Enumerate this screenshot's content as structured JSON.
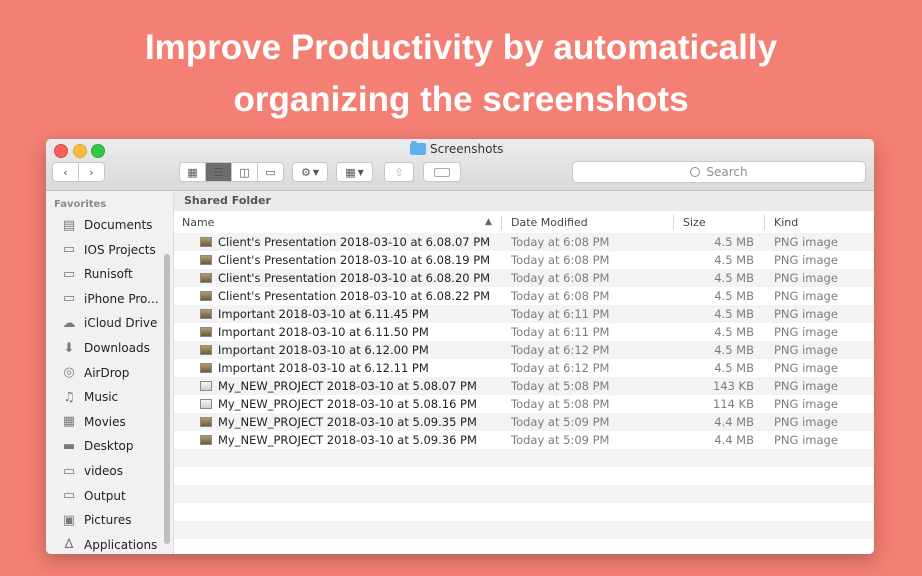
{
  "headline": {
    "line1": "Improve Productivity by automatically",
    "line2": "organizing the screenshots"
  },
  "window": {
    "title": "Screenshots",
    "search_placeholder": "Search",
    "back_icon": "chevron-left",
    "forward_icon": "chevron-right"
  },
  "sidebar": {
    "heading": "Favorites",
    "items": [
      {
        "label": "Documents",
        "icon": "documents-icon"
      },
      {
        "label": "IOS Projects",
        "icon": "folder-icon"
      },
      {
        "label": "Runisoft",
        "icon": "folder-icon"
      },
      {
        "label": "iPhone Pro...",
        "icon": "folder-icon"
      },
      {
        "label": "iCloud Drive",
        "icon": "cloud-icon"
      },
      {
        "label": "Downloads",
        "icon": "downloads-icon"
      },
      {
        "label": "AirDrop",
        "icon": "airdrop-icon"
      },
      {
        "label": "Music",
        "icon": "music-icon"
      },
      {
        "label": "Movies",
        "icon": "movies-icon"
      },
      {
        "label": "Desktop",
        "icon": "desktop-icon"
      },
      {
        "label": "videos",
        "icon": "folder-icon"
      },
      {
        "label": "Output",
        "icon": "folder-icon"
      },
      {
        "label": "Pictures",
        "icon": "pictures-icon"
      },
      {
        "label": "Applications",
        "icon": "applications-icon"
      }
    ]
  },
  "content": {
    "section": "Shared Folder",
    "columns": {
      "name": "Name",
      "date": "Date Modified",
      "size": "Size",
      "kind": "Kind"
    },
    "files": [
      {
        "name": "Client's Presentation 2018-03-10 at 6.08.07 PM",
        "date": "Today at 6:08 PM",
        "size": "4.5 MB",
        "kind": "PNG image"
      },
      {
        "name": "Client's Presentation 2018-03-10 at 6.08.19 PM",
        "date": "Today at 6:08 PM",
        "size": "4.5 MB",
        "kind": "PNG image"
      },
      {
        "name": "Client's Presentation 2018-03-10 at 6.08.20 PM",
        "date": "Today at 6:08 PM",
        "size": "4.5 MB",
        "kind": "PNG image"
      },
      {
        "name": "Client's Presentation 2018-03-10 at 6.08.22 PM",
        "date": "Today at 6:08 PM",
        "size": "4.5 MB",
        "kind": "PNG image"
      },
      {
        "name": "Important 2018-03-10 at 6.11.45 PM",
        "date": "Today at 6:11 PM",
        "size": "4.5 MB",
        "kind": "PNG image"
      },
      {
        "name": "Important 2018-03-10 at 6.11.50 PM",
        "date": "Today at 6:11 PM",
        "size": "4.5 MB",
        "kind": "PNG image"
      },
      {
        "name": "Important 2018-03-10 at 6.12.00 PM",
        "date": "Today at 6:12 PM",
        "size": "4.5 MB",
        "kind": "PNG image"
      },
      {
        "name": "Important 2018-03-10 at 6.12.11 PM",
        "date": "Today at 6:12 PM",
        "size": "4.5 MB",
        "kind": "PNG image"
      },
      {
        "name": "My_NEW_PROJECT 2018-03-10 at 5.08.07 PM",
        "date": "Today at 5:08 PM",
        "size": "143 KB",
        "kind": "PNG image"
      },
      {
        "name": "My_NEW_PROJECT 2018-03-10 at 5.08.16 PM",
        "date": "Today at 5:08 PM",
        "size": "114 KB",
        "kind": "PNG image"
      },
      {
        "name": "My_NEW_PROJECT 2018-03-10 at 5.09.35 PM",
        "date": "Today at 5:09 PM",
        "size": "4.4 MB",
        "kind": "PNG image"
      },
      {
        "name": "My_NEW_PROJECT 2018-03-10 at 5.09.36 PM",
        "date": "Today at 5:09 PM",
        "size": "4.4 MB",
        "kind": "PNG image"
      }
    ]
  },
  "colors": {
    "background": "#f47f74",
    "headline": "#ffffff"
  }
}
